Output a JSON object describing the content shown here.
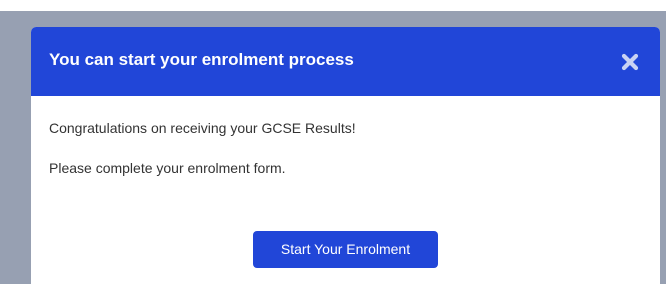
{
  "modal": {
    "title": "You can start your enrolment process",
    "close_icon": "close-icon",
    "messages": [
      "Congratulations on receiving your GCSE Results!",
      "Please complete your enrolment form."
    ],
    "primary_button_label": "Start Your Enrolment"
  },
  "colors": {
    "backdrop": "#97a0b2",
    "brand_blue": "#2146d8",
    "header_text": "#ffffff",
    "body_text": "#333333"
  }
}
